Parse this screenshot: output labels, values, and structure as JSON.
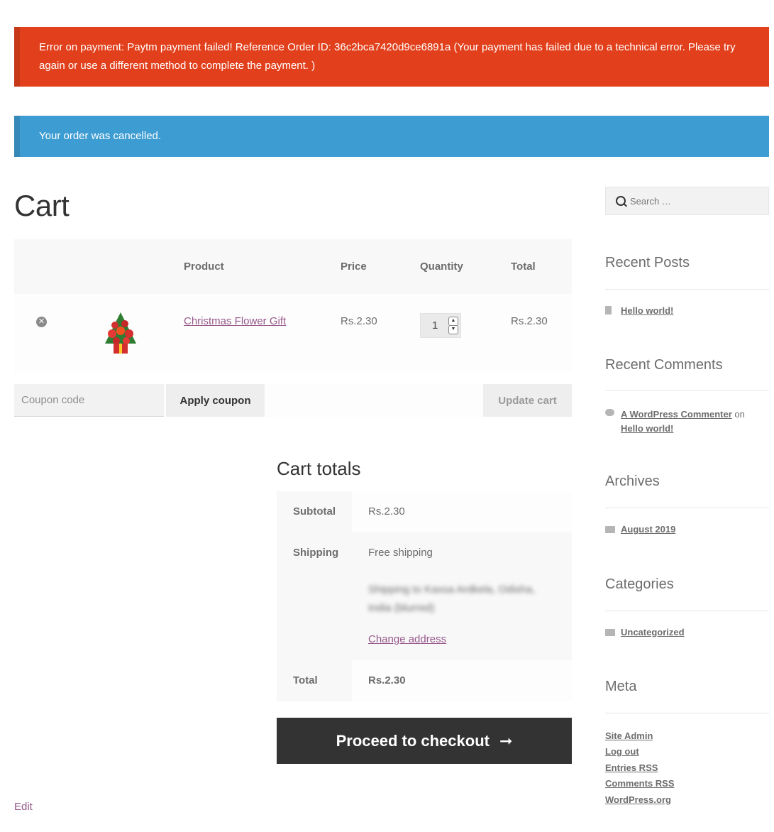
{
  "notices": {
    "error": "Error on payment: Paytm payment failed! Reference Order ID: 36c2bca7420d9ce6891a (Your payment has failed due to a technical error. Please try again or use a different method to complete the payment. )",
    "info": "Your order was cancelled."
  },
  "page": {
    "title": "Cart"
  },
  "cart_table": {
    "headers": {
      "product": "Product",
      "price": "Price",
      "quantity": "Quantity",
      "total": "Total"
    },
    "items": [
      {
        "name": "Christmas Flower Gift",
        "price": "Rs.2.30",
        "quantity": "1",
        "total": "Rs.2.30"
      }
    ]
  },
  "coupon": {
    "placeholder": "Coupon code",
    "apply_label": "Apply coupon",
    "update_label": "Update cart"
  },
  "totals": {
    "title": "Cart totals",
    "subtotal_label": "Subtotal",
    "subtotal_value": "Rs.2.30",
    "shipping_label": "Shipping",
    "shipping_value": "Free shipping",
    "shipping_address": "Shipping to Kaxsa Ardkela, Odisha, India (blurred)",
    "change_address": "Change address",
    "total_label": "Total",
    "total_value": "Rs.2.30",
    "checkout_label": "Proceed to checkout"
  },
  "edit_label": "Edit",
  "sidebar": {
    "search_placeholder": "Search …",
    "recent_posts": {
      "title": "Recent Posts",
      "items": [
        "Hello world!"
      ]
    },
    "recent_comments": {
      "title": "Recent Comments",
      "author": "A WordPress Commenter",
      "on": "on",
      "post": "Hello world!"
    },
    "archives": {
      "title": "Archives",
      "items": [
        "August 2019"
      ]
    },
    "categories": {
      "title": "Categories",
      "items": [
        "Uncategorized"
      ]
    },
    "meta": {
      "title": "Meta",
      "items": [
        "Site Admin",
        "Log out",
        "Entries RSS",
        "Comments RSS",
        "WordPress.org"
      ]
    }
  },
  "colors": {
    "error": "#e2401c",
    "info": "#3d9cd2",
    "link": "#96588a",
    "checkout": "#333333"
  },
  "icons": [
    "remove-icon",
    "search-icon",
    "document-icon",
    "comment-bubble-icon",
    "folder-icon",
    "arrow-right-icon"
  ]
}
